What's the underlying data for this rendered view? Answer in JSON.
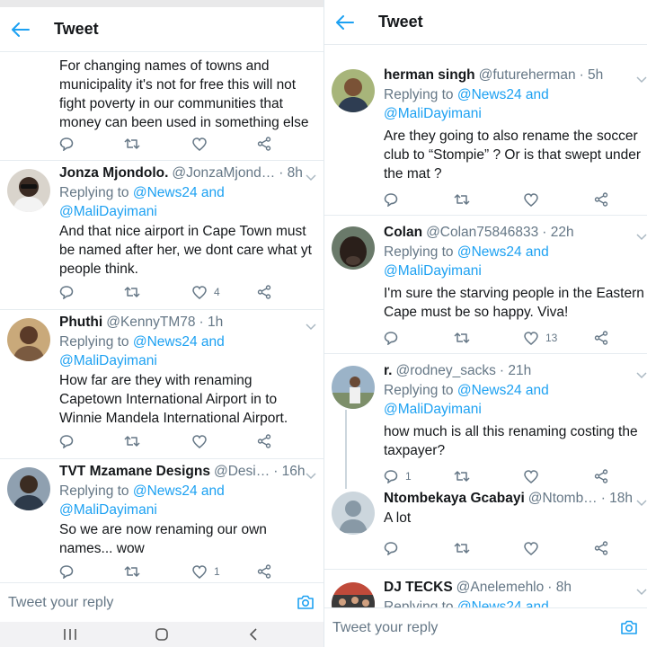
{
  "screen": {
    "title": "Tweet",
    "reply_placeholder": "Tweet your reply"
  },
  "colors": {
    "accent": "#1da1f2",
    "secondary_text": "#657786",
    "divider": "#e6ecf0"
  },
  "left_feed": {
    "truncated_text": "For changing names of towns and municipality it's not for free this will not fight poverty in our communities that money can been used in something else .",
    "tweets": [
      {
        "name": "Jonza Mjondolo.",
        "handle": "@JonzaMjond…",
        "time": "· 8h",
        "replying_prefix": "Replying to ",
        "replying_to": "@News24 and @MaliDayimani",
        "text": "And that nice airport in Cape Town must be named after her, we dont care what yt people think.",
        "likes": "4",
        "replies": "",
        "avatar_icon": "person-sunglasses-avatar"
      },
      {
        "name": "Phuthi",
        "handle": "@KennyTM78",
        "time": "· 1h",
        "replying_prefix": "Replying to ",
        "replying_to": "@News24 and @MaliDayimani",
        "text": "How far are they with renaming Capetown International Airport in to Winnie Mandela International Airport.",
        "likes": "",
        "replies": "",
        "avatar_icon": "person-avatar"
      },
      {
        "name": "TVT Mzamane Designs",
        "handle": "@Desi…",
        "time": "· 16h",
        "replying_prefix": "Replying to ",
        "replying_to": "@News24 and @MaliDayimani",
        "text": "So we are now renaming our own names... wow",
        "likes": "1",
        "replies": "",
        "avatar_icon": "person-avatar"
      }
    ]
  },
  "right_feed": {
    "tweets": [
      {
        "name": "herman singh",
        "handle": "@futureherman",
        "time": "· 5h",
        "replying_prefix": "Replying to ",
        "replying_to": "@News24 and @MaliDayimani",
        "text": "Are they going to also rename the soccer club to “Stompie” ?  Or is that swept under the mat ?",
        "likes": "",
        "replies": "",
        "avatar_icon": "person-avatar"
      },
      {
        "name": "Colan",
        "handle": "@Colan75846833",
        "time": "· 22h",
        "replying_prefix": "Replying to ",
        "replying_to": "@News24 and @MaliDayimani",
        "text": "I'm sure the starving people in the Eastern Cape must be so happy. Viva!",
        "likes": "13",
        "replies": "",
        "avatar_icon": "cow-avatar"
      },
      {
        "name": "r.",
        "handle": "@rodney_sacks",
        "time": "· 21h",
        "replying_prefix": "Replying to ",
        "replying_to": "@News24 and @MaliDayimani",
        "text": "how much is all this renaming costing the taxpayer?",
        "likes": "",
        "replies": "1",
        "avatar_icon": "person-outdoor-avatar"
      },
      {
        "name": "Ntombekaya Gcabayi",
        "handle": "@Ntomb…",
        "time": "· 18h",
        "replying_prefix": "",
        "replying_to": "",
        "text": "A lot",
        "likes": "",
        "replies": "",
        "avatar_icon": "default-user-avatar"
      },
      {
        "name": "DJ TECKS",
        "handle": "@Anelemehlo",
        "time": "· 8h",
        "replying_prefix": "Replying to ",
        "replying_to": "@News24 and",
        "text": "",
        "likes": "",
        "replies": "",
        "avatar_icon": "crowd-avatar"
      }
    ]
  }
}
